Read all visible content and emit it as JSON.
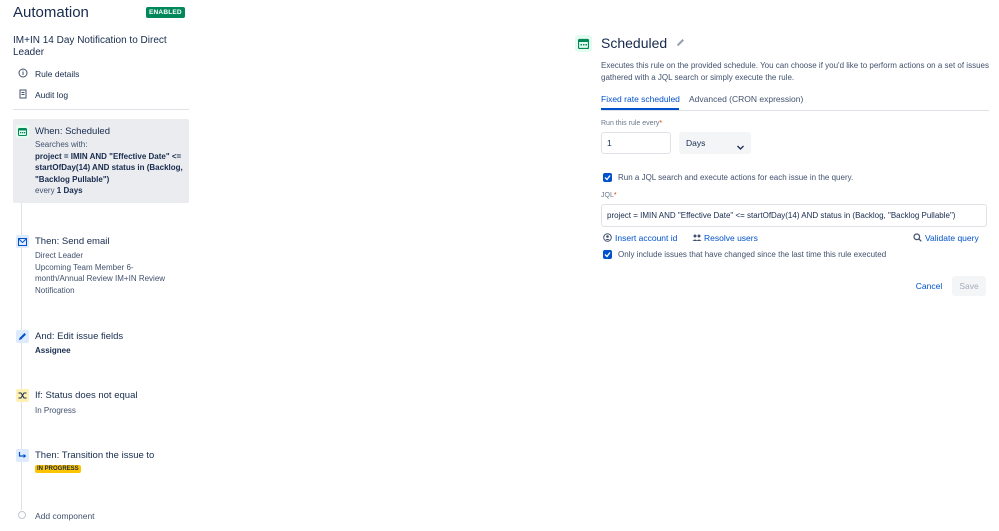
{
  "header": {
    "title": "Automation",
    "status_badge": "ENABLED",
    "rule_name": "IM+IN 14 Day Notification to Direct Leader"
  },
  "sidebar": {
    "links": [
      {
        "label": "Rule details",
        "icon": "info-icon"
      },
      {
        "label": "Audit log",
        "icon": "document-icon"
      }
    ],
    "components": [
      {
        "title": "When: Scheduled",
        "icon": "calendar-icon",
        "line1": "Searches with:",
        "query": "project = IMIN AND \"Effective Date\" <= startOfDay(14) AND status in (Backlog, \"Backlog Pullable\")",
        "every_prefix": "every",
        "every_value": "1 Days"
      },
      {
        "title": "Then: Send email",
        "icon": "envelope-icon",
        "line1": "Direct Leader",
        "line2": "Upcoming Team Member 6-month/Annual Review IM+IN Review Notification"
      },
      {
        "title": "And: Edit issue fields",
        "icon": "pencil-icon",
        "line1": "Assignee"
      },
      {
        "title": "If: Status does not equal",
        "icon": "shuffle-icon",
        "line1": "In Progress"
      },
      {
        "title": "Then: Transition the issue to",
        "icon": "transition-icon",
        "lozenge": "IN PROGRESS"
      }
    ],
    "add_component": "Add component"
  },
  "panel": {
    "title": "Scheduled",
    "description": "Executes this rule on the provided schedule. You can choose if you'd like to perform actions on a set of issues gathered with a JQL search or simply execute the rule.",
    "tabs": [
      "Fixed rate scheduled",
      "Advanced (CRON expression)"
    ],
    "run_every_label": "Run this rule every",
    "run_every_value": "1",
    "unit_value": "Days",
    "jql_checkbox_label": "Run a JQL search and execute actions for each issue in the query.",
    "jql_label": "JQL",
    "jql_value": "project = IMIN AND \"Effective Date\" <= startOfDay(14) AND status in (Backlog, \"Backlog Pullable\")",
    "insert_account_id": "Insert account id",
    "resolve_users": "Resolve users",
    "validate_query": "Validate query",
    "only_changed_label": "Only include issues that have changed since the last time this rule executed",
    "cancel": "Cancel",
    "save": "Save"
  },
  "colors": {
    "accent": "#0052cc",
    "enabled": "#00875a",
    "lozenge": "#ffc400",
    "required": "#de350b"
  }
}
